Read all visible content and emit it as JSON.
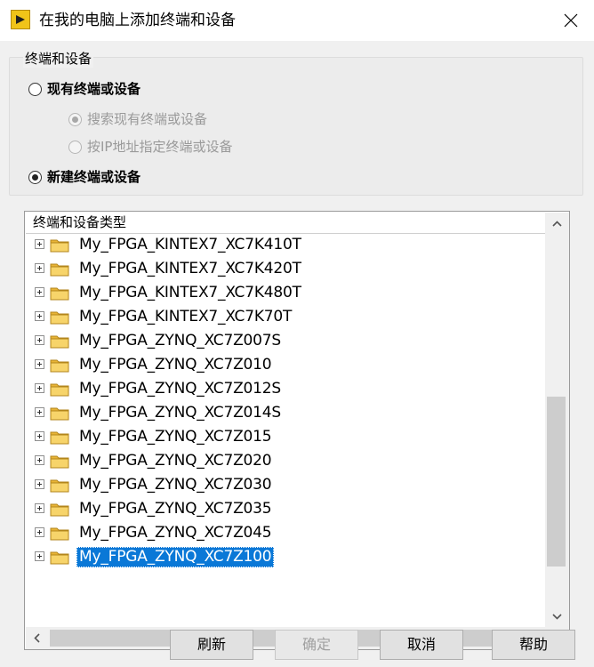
{
  "window": {
    "title": "在我的电脑上添加终端和设备"
  },
  "group": {
    "legend": "终端和设备",
    "options": [
      {
        "label": "现有终端或设备",
        "checked": false,
        "disabled": false,
        "bold": true
      },
      {
        "label": "搜索现有终端或设备",
        "checked": true,
        "disabled": true,
        "bold": false
      },
      {
        "label": "按IP地址指定终端或设备",
        "checked": false,
        "disabled": true,
        "bold": false
      },
      {
        "label": "新建终端或设备",
        "checked": true,
        "disabled": false,
        "bold": true
      }
    ]
  },
  "tree": {
    "header": "终端和设备类型",
    "items": [
      {
        "label": "My_FPGA_KINTEX7_XC7K410T",
        "selected": false
      },
      {
        "label": "My_FPGA_KINTEX7_XC7K420T",
        "selected": false
      },
      {
        "label": "My_FPGA_KINTEX7_XC7K480T",
        "selected": false
      },
      {
        "label": "My_FPGA_KINTEX7_XC7K70T",
        "selected": false
      },
      {
        "label": "My_FPGA_ZYNQ_XC7Z007S",
        "selected": false
      },
      {
        "label": "My_FPGA_ZYNQ_XC7Z010",
        "selected": false
      },
      {
        "label": "My_FPGA_ZYNQ_XC7Z012S",
        "selected": false
      },
      {
        "label": "My_FPGA_ZYNQ_XC7Z014S",
        "selected": false
      },
      {
        "label": "My_FPGA_ZYNQ_XC7Z015",
        "selected": false
      },
      {
        "label": "My_FPGA_ZYNQ_XC7Z020",
        "selected": false
      },
      {
        "label": "My_FPGA_ZYNQ_XC7Z030",
        "selected": false
      },
      {
        "label": "My_FPGA_ZYNQ_XC7Z035",
        "selected": false
      },
      {
        "label": "My_FPGA_ZYNQ_XC7Z045",
        "selected": false
      },
      {
        "label": "My_FPGA_ZYNQ_XC7Z100",
        "selected": true
      }
    ]
  },
  "buttons": {
    "refresh": "刷新",
    "ok": "确定",
    "cancel": "取消",
    "help": "帮助"
  },
  "icons": {
    "app": "labview-arrow-icon",
    "close": "close-icon",
    "folder": "folder-icon",
    "expander": "plus-expander-icon"
  },
  "colors": {
    "selection": "#0a78d7",
    "folder": "#f3c851",
    "app_icon": "#f0c419"
  }
}
